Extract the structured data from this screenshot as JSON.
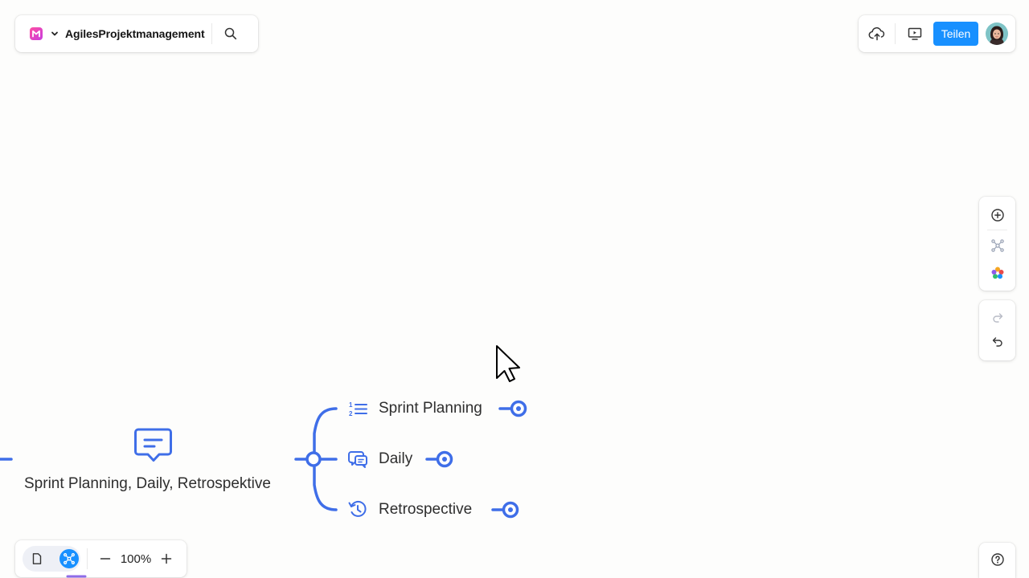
{
  "header": {
    "doc_title": "AgilesProjektmanagement",
    "share_label": "Teilen"
  },
  "zoom": {
    "level": "100%"
  },
  "mindmap": {
    "central_topic": "Sprint Planning, Daily, Retrospektive",
    "children": [
      {
        "label": "Sprint Planning",
        "icon": "numbered-list-icon"
      },
      {
        "label": "Daily",
        "icon": "chat-bubbles-icon"
      },
      {
        "label": "Retrospective",
        "icon": "history-icon"
      }
    ]
  },
  "colors": {
    "accent": "#1890ff",
    "mindmap_line": "#3f6ee8",
    "logo_pink": "#ff4fa0"
  }
}
